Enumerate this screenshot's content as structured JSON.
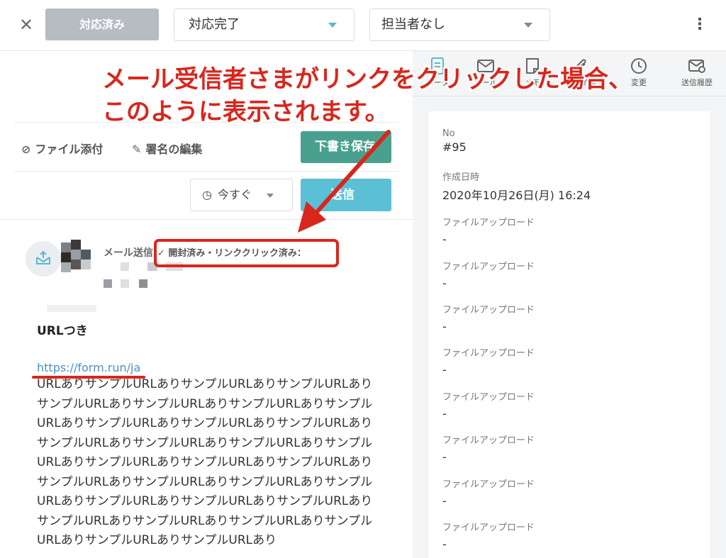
{
  "topbar": {
    "close_icon": "close-icon",
    "done_label": "対応済み",
    "status_value": "対応完了",
    "assignee_value": "担当者なし",
    "more_icon": "kebab-menu-icon"
  },
  "tabs": [
    {
      "label": "データ",
      "icon": "document-icon"
    },
    {
      "label": "メール",
      "icon": "envelope-icon"
    },
    {
      "label": "メモ",
      "icon": "memo-icon"
    },
    {
      "label": "ファイル",
      "icon": "paperclip-icon"
    },
    {
      "label": "変更",
      "icon": "clock-icon"
    },
    {
      "label": "送信履歴",
      "icon": "mail-history-icon"
    }
  ],
  "details": {
    "no_label": "No",
    "no_value": "#95",
    "created_label": "作成日時",
    "created_value": "2020年10月26日(月) 16:24",
    "uploads": [
      {
        "label": "ファイルアップロード",
        "value": "-"
      },
      {
        "label": "ファイルアップロード",
        "value": "-"
      },
      {
        "label": "ファイルアップロード",
        "value": "-"
      },
      {
        "label": "ファイルアップロード",
        "value": "-"
      },
      {
        "label": "ファイルアップロード",
        "value": "-"
      },
      {
        "label": "ファイルアップロード",
        "value": "-"
      },
      {
        "label": "ファイルアップロード",
        "value": "-"
      },
      {
        "label": "ファイルアップロード",
        "value": "-"
      }
    ]
  },
  "compose": {
    "attach_label": "ファイル添付",
    "signature_label": "署名の編集",
    "draft_label": "下書き保存",
    "schedule_label": "今すぐ",
    "send_label": "送信"
  },
  "message": {
    "sender_label": "メール送信",
    "status": "✓ 開封済み・リンククリック済み：",
    "subject": "URLつき",
    "link": "https://form.run/ja",
    "body": "URLありサンプルURLありサンプルURLありサンプルURLありサンプルURLありサンプルURLありサンプルURLありサンプルURLありサンプルURLありサンプルURLありサンプルURLありサンプルURLありサンプルURLありサンプルURLありサンプルURLありサンプルURLありサンプルURLありサンプルURLありサンプルURLありサンプルURLありサンプルURLありサンプルURLありサンプルURLありサンプルURLありサンプルURLありサンプルURLありサンプルURLありサンプルURLありサンプルURLありサンプルURLありサンプルURLあり"
  },
  "annotation": {
    "line1": "メール受信者さまがリンクをクリックした場合、",
    "line2": "このように表示されます。",
    "color": "#d9261c"
  },
  "colors": {
    "accent": "#59b8cf",
    "draft_button": "#4aa08e",
    "send_button": "#5bbfd6",
    "done_button": "#b6bcc2",
    "link": "#4a90c8"
  }
}
